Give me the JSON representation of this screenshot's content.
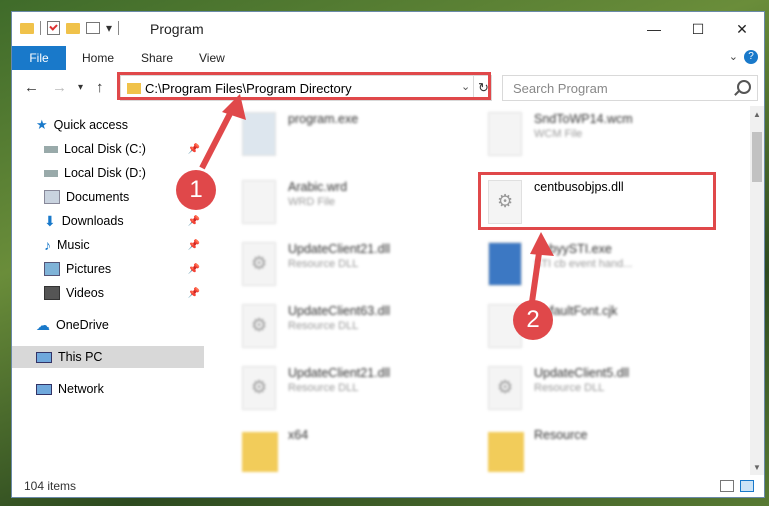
{
  "window": {
    "title": "Program"
  },
  "ribbon": {
    "tabs": [
      "File",
      "Home",
      "Share",
      "View"
    ]
  },
  "address": {
    "path": "C:\\Program Files\\Program Directory"
  },
  "search": {
    "placeholder": "Search Program"
  },
  "sidebar": {
    "items": [
      {
        "label": "Quick access",
        "icon": "star-icon"
      },
      {
        "label": "Local Disk (C:)",
        "icon": "disk-icon"
      },
      {
        "label": "Local Disk (D:)",
        "icon": "disk-icon"
      },
      {
        "label": "Documents",
        "icon": "documents-icon"
      },
      {
        "label": "Downloads",
        "icon": "download-icon"
      },
      {
        "label": "Music",
        "icon": "music-icon"
      },
      {
        "label": "Pictures",
        "icon": "pictures-icon"
      },
      {
        "label": "Videos",
        "icon": "videos-icon"
      },
      {
        "label": "OneDrive",
        "icon": "cloud-icon"
      },
      {
        "label": "This PC",
        "icon": "pc-icon"
      },
      {
        "label": "Network",
        "icon": "network-icon"
      }
    ]
  },
  "files": [
    {
      "name": "program.exe",
      "type": ""
    },
    {
      "name": "SndToWP14.wcm",
      "type": "WCM File"
    },
    {
      "name": "Arabic.wrd",
      "type": "WRD File"
    },
    {
      "name": "centbusobjps.dll",
      "type": ""
    },
    {
      "name": "UpdateClient21.dll",
      "type": "Resource DLL"
    },
    {
      "name": "AbbyySTI.exe",
      "type": "STI cb event hand..."
    },
    {
      "name": "UpdateClient63.dll",
      "type": "Resource DLL"
    },
    {
      "name": "DefaultFont.cjk",
      "type": "File"
    },
    {
      "name": "UpdateClient21.dll",
      "type": "Resource DLL"
    },
    {
      "name": "UpdateClient5.dll",
      "type": "Resource DLL"
    },
    {
      "name": "x64",
      "type": ""
    },
    {
      "name": "Resource",
      "type": ""
    }
  ],
  "status": {
    "count": "104 items"
  },
  "annotations": {
    "step1": "1",
    "step2": "2"
  },
  "colors": {
    "accent": "#1979ca",
    "highlight": "#e0484a"
  }
}
